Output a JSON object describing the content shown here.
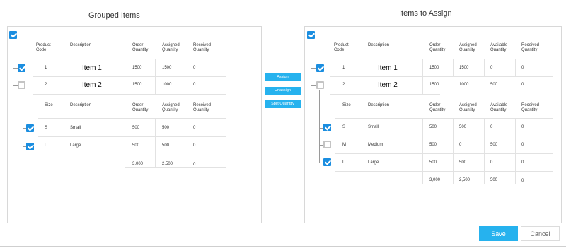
{
  "left": {
    "title": "Grouped Items",
    "top_headers": [
      "Product Code",
      "Description",
      "Order Quantity",
      "Assigned Quantity",
      "Received Quantity"
    ],
    "items": [
      {
        "code": "1",
        "description": "Item 1",
        "order": "1500",
        "assigned": "1500",
        "received": "0",
        "checked": true
      },
      {
        "code": "2",
        "description": "Item 2",
        "order": "1500",
        "assigned": "1000",
        "received": "0",
        "checked": false
      }
    ],
    "sub_headers": [
      "Size",
      "Description",
      "Order Quantity",
      "Assigned Quantity",
      "Received Quantity"
    ],
    "sub_items": [
      {
        "size": "S",
        "description": "Small",
        "order": "500",
        "assigned": "500",
        "received": "0",
        "checked": true
      },
      {
        "size": "L",
        "description": "Large",
        "order": "500",
        "assigned": "500",
        "received": "0",
        "checked": true
      }
    ],
    "totals": {
      "order": "3,000",
      "assigned": "2,500",
      "received": "0"
    }
  },
  "middle": {
    "assign": "Assign",
    "unassign": "Unassign",
    "split": "Split Quantity"
  },
  "right": {
    "title": "Items to Assign",
    "top_headers": [
      "Product Code",
      "Description",
      "Order Quantity",
      "Assigned Quantity",
      "Available Quantity",
      "Received Quantity"
    ],
    "items": [
      {
        "code": "1",
        "description": "Item 1",
        "order": "1500",
        "assigned": "1500",
        "available": "0",
        "received": "0",
        "checked": true
      },
      {
        "code": "2",
        "description": "Item 2",
        "order": "1500",
        "assigned": "1000",
        "available": "500",
        "received": "0",
        "checked": false
      }
    ],
    "sub_headers": [
      "Size",
      "Description",
      "Order Quantity",
      "Assigned Quantity",
      "Available Quantity",
      "Received Quantity"
    ],
    "sub_items": [
      {
        "size": "S",
        "description": "Small",
        "order": "500",
        "assigned": "500",
        "available": "0",
        "received": "0",
        "checked": true
      },
      {
        "size": "M",
        "description": "Medium",
        "order": "500",
        "assigned": "0",
        "available": "500",
        "received": "0",
        "checked": false
      },
      {
        "size": "L",
        "description": "Large",
        "order": "500",
        "assigned": "500",
        "available": "0",
        "received": "0",
        "checked": true
      }
    ],
    "totals": {
      "order": "3,000",
      "assigned": "2,500",
      "available": "500",
      "received": "0"
    }
  },
  "footer": {
    "save": "Save",
    "cancel": "Cancel"
  },
  "colors": {
    "accent": "#26b2ee",
    "checkbox": "#1b8ee0"
  }
}
